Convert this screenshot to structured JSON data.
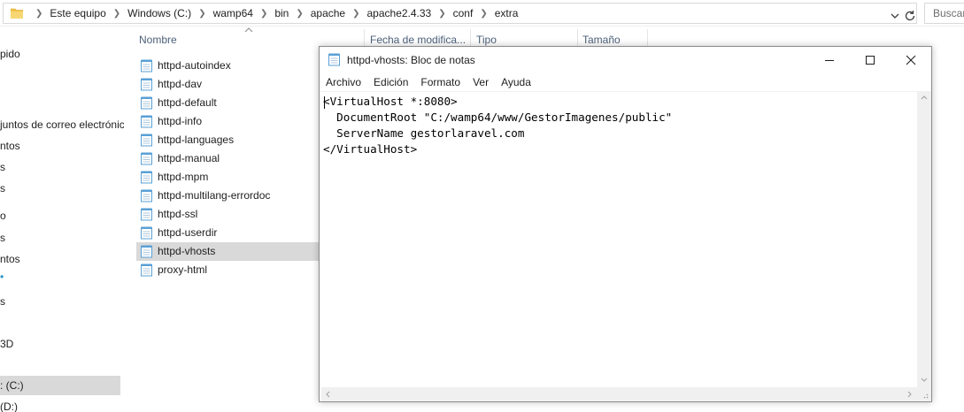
{
  "explorer": {
    "breadcrumbs": [
      "Este equipo",
      "Windows (C:)",
      "wamp64",
      "bin",
      "apache",
      "apache2.4.33",
      "conf",
      "extra"
    ],
    "search_placeholder": "Buscar",
    "nav_items": [
      {
        "label": "pido"
      },
      {
        "label": "juntos de correo electrónico"
      },
      {
        "label": "ntos"
      },
      {
        "label": "s"
      },
      {
        "label": "s"
      },
      {
        "label": "o"
      },
      {
        "label": "s"
      },
      {
        "label": "ntos"
      },
      {
        "label": "s"
      },
      {
        "label": "3D"
      },
      {
        "label": ": (C:)",
        "selected": true
      },
      {
        "label": " (D:)"
      }
    ],
    "columns": {
      "name": "Nombre",
      "modified": "Fecha de modifica...",
      "type": "Tipo",
      "size": "Tamaño"
    },
    "files": [
      {
        "name": "httpd-autoindex"
      },
      {
        "name": "httpd-dav"
      },
      {
        "name": "httpd-default"
      },
      {
        "name": "httpd-info"
      },
      {
        "name": "httpd-languages"
      },
      {
        "name": "httpd-manual"
      },
      {
        "name": "httpd-mpm"
      },
      {
        "name": "httpd-multilang-errordoc"
      },
      {
        "name": "httpd-ssl"
      },
      {
        "name": "httpd-userdir"
      },
      {
        "name": "httpd-vhosts",
        "selected": true
      },
      {
        "name": "proxy-html"
      }
    ]
  },
  "notepad": {
    "title": "httpd-vhosts: Bloc de notas",
    "menu": [
      "Archivo",
      "Edición",
      "Formato",
      "Ver",
      "Ayuda"
    ],
    "lines": [
      "<VirtualHost *:8080>",
      "  DocumentRoot \"C:/wamp64/www/GestorImagenes/public\"",
      "  ServerName gestorlaravel.com",
      "</VirtualHost>"
    ]
  },
  "colors": {
    "selection": "#d9d9d9",
    "column_header_text": "#4c607a",
    "folder_yellow": "#f0c24a",
    "notepad_icon_blue": "#5aa0d6"
  },
  "icons": {
    "address_folder": "folder-icon",
    "file": "notepad-file-icon",
    "refresh": "refresh-icon",
    "dropdown": "chevron-down-icon"
  }
}
